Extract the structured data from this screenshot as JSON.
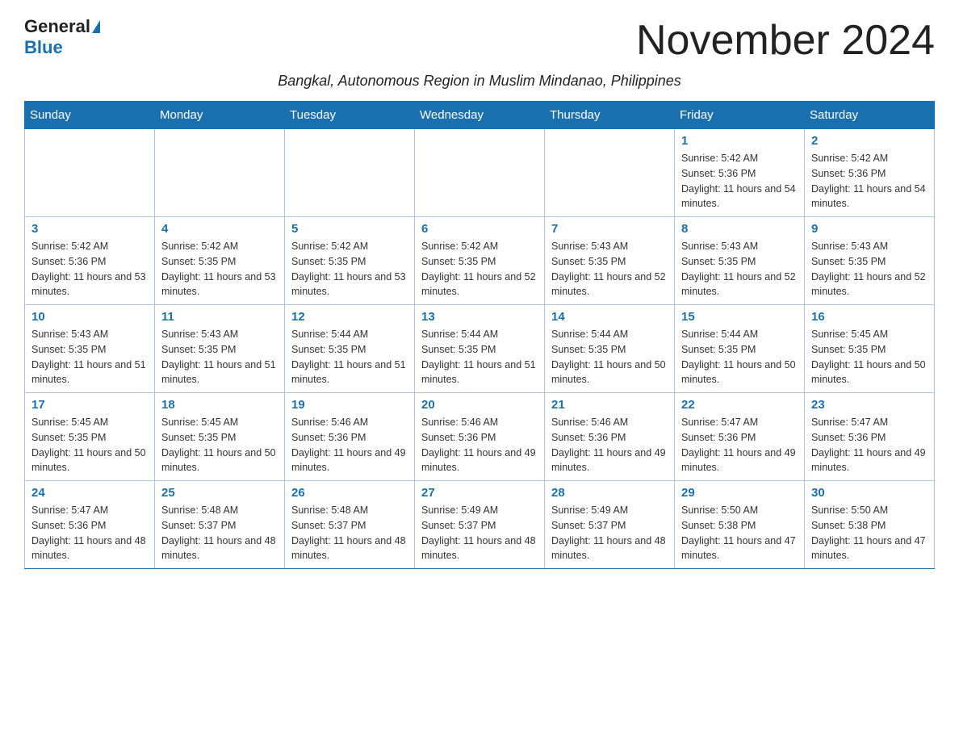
{
  "header": {
    "logo_general": "General",
    "logo_blue": "Blue",
    "month_title": "November 2024",
    "subtitle": "Bangkal, Autonomous Region in Muslim Mindanao, Philippines"
  },
  "days_of_week": [
    "Sunday",
    "Monday",
    "Tuesday",
    "Wednesday",
    "Thursday",
    "Friday",
    "Saturday"
  ],
  "weeks": [
    [
      {
        "day": "",
        "info": ""
      },
      {
        "day": "",
        "info": ""
      },
      {
        "day": "",
        "info": ""
      },
      {
        "day": "",
        "info": ""
      },
      {
        "day": "",
        "info": ""
      },
      {
        "day": "1",
        "info": "Sunrise: 5:42 AM\nSunset: 5:36 PM\nDaylight: 11 hours and 54 minutes."
      },
      {
        "day": "2",
        "info": "Sunrise: 5:42 AM\nSunset: 5:36 PM\nDaylight: 11 hours and 54 minutes."
      }
    ],
    [
      {
        "day": "3",
        "info": "Sunrise: 5:42 AM\nSunset: 5:36 PM\nDaylight: 11 hours and 53 minutes."
      },
      {
        "day": "4",
        "info": "Sunrise: 5:42 AM\nSunset: 5:35 PM\nDaylight: 11 hours and 53 minutes."
      },
      {
        "day": "5",
        "info": "Sunrise: 5:42 AM\nSunset: 5:35 PM\nDaylight: 11 hours and 53 minutes."
      },
      {
        "day": "6",
        "info": "Sunrise: 5:42 AM\nSunset: 5:35 PM\nDaylight: 11 hours and 52 minutes."
      },
      {
        "day": "7",
        "info": "Sunrise: 5:43 AM\nSunset: 5:35 PM\nDaylight: 11 hours and 52 minutes."
      },
      {
        "day": "8",
        "info": "Sunrise: 5:43 AM\nSunset: 5:35 PM\nDaylight: 11 hours and 52 minutes."
      },
      {
        "day": "9",
        "info": "Sunrise: 5:43 AM\nSunset: 5:35 PM\nDaylight: 11 hours and 52 minutes."
      }
    ],
    [
      {
        "day": "10",
        "info": "Sunrise: 5:43 AM\nSunset: 5:35 PM\nDaylight: 11 hours and 51 minutes."
      },
      {
        "day": "11",
        "info": "Sunrise: 5:43 AM\nSunset: 5:35 PM\nDaylight: 11 hours and 51 minutes."
      },
      {
        "day": "12",
        "info": "Sunrise: 5:44 AM\nSunset: 5:35 PM\nDaylight: 11 hours and 51 minutes."
      },
      {
        "day": "13",
        "info": "Sunrise: 5:44 AM\nSunset: 5:35 PM\nDaylight: 11 hours and 51 minutes."
      },
      {
        "day": "14",
        "info": "Sunrise: 5:44 AM\nSunset: 5:35 PM\nDaylight: 11 hours and 50 minutes."
      },
      {
        "day": "15",
        "info": "Sunrise: 5:44 AM\nSunset: 5:35 PM\nDaylight: 11 hours and 50 minutes."
      },
      {
        "day": "16",
        "info": "Sunrise: 5:45 AM\nSunset: 5:35 PM\nDaylight: 11 hours and 50 minutes."
      }
    ],
    [
      {
        "day": "17",
        "info": "Sunrise: 5:45 AM\nSunset: 5:35 PM\nDaylight: 11 hours and 50 minutes."
      },
      {
        "day": "18",
        "info": "Sunrise: 5:45 AM\nSunset: 5:35 PM\nDaylight: 11 hours and 50 minutes."
      },
      {
        "day": "19",
        "info": "Sunrise: 5:46 AM\nSunset: 5:36 PM\nDaylight: 11 hours and 49 minutes."
      },
      {
        "day": "20",
        "info": "Sunrise: 5:46 AM\nSunset: 5:36 PM\nDaylight: 11 hours and 49 minutes."
      },
      {
        "day": "21",
        "info": "Sunrise: 5:46 AM\nSunset: 5:36 PM\nDaylight: 11 hours and 49 minutes."
      },
      {
        "day": "22",
        "info": "Sunrise: 5:47 AM\nSunset: 5:36 PM\nDaylight: 11 hours and 49 minutes."
      },
      {
        "day": "23",
        "info": "Sunrise: 5:47 AM\nSunset: 5:36 PM\nDaylight: 11 hours and 49 minutes."
      }
    ],
    [
      {
        "day": "24",
        "info": "Sunrise: 5:47 AM\nSunset: 5:36 PM\nDaylight: 11 hours and 48 minutes."
      },
      {
        "day": "25",
        "info": "Sunrise: 5:48 AM\nSunset: 5:37 PM\nDaylight: 11 hours and 48 minutes."
      },
      {
        "day": "26",
        "info": "Sunrise: 5:48 AM\nSunset: 5:37 PM\nDaylight: 11 hours and 48 minutes."
      },
      {
        "day": "27",
        "info": "Sunrise: 5:49 AM\nSunset: 5:37 PM\nDaylight: 11 hours and 48 minutes."
      },
      {
        "day": "28",
        "info": "Sunrise: 5:49 AM\nSunset: 5:37 PM\nDaylight: 11 hours and 48 minutes."
      },
      {
        "day": "29",
        "info": "Sunrise: 5:50 AM\nSunset: 5:38 PM\nDaylight: 11 hours and 47 minutes."
      },
      {
        "day": "30",
        "info": "Sunrise: 5:50 AM\nSunset: 5:38 PM\nDaylight: 11 hours and 47 minutes."
      }
    ]
  ]
}
